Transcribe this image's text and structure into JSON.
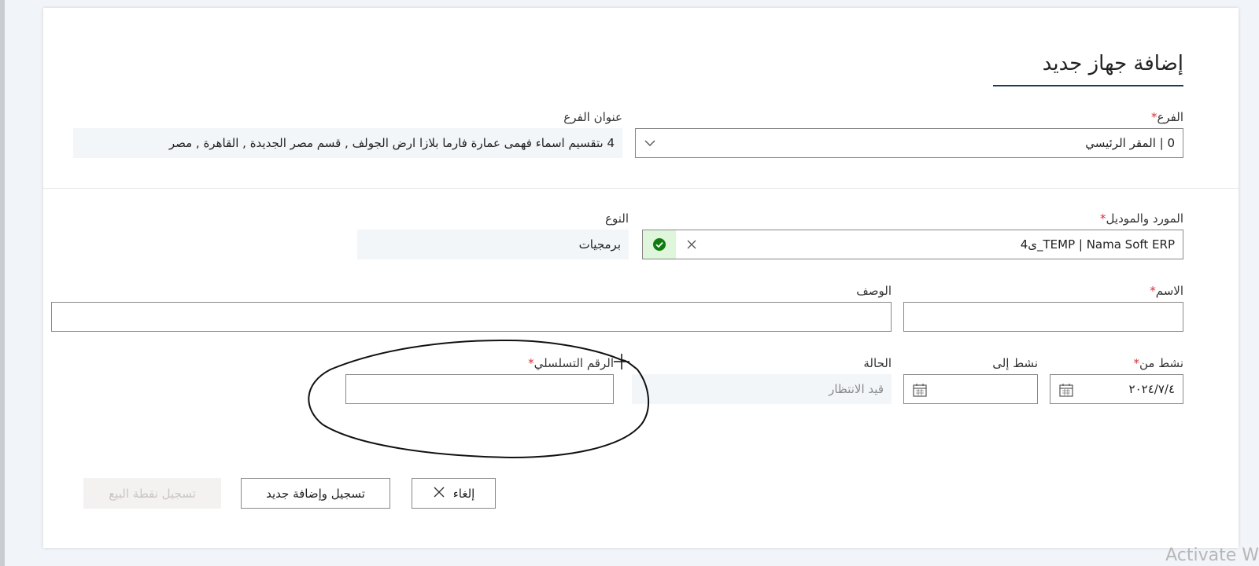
{
  "form": {
    "title": "إضافة جهاز جديد",
    "branch": {
      "label": "الفرع",
      "required_mark": "*",
      "value": "0 | المقر الرئيسي"
    },
    "branch_address": {
      "label": "عنوان الفرع",
      "value": "4 ىتقسيم اسماء فهمى عمارة فارما بلازا ارض الجولف , قسم مصر الجديدة , القاهرة , مصر"
    },
    "supplier_model": {
      "label": "المورد والموديل",
      "required_mark": "*",
      "value": "TEMP | Nama Soft ERP_ى4"
    },
    "type": {
      "label": "النوع",
      "value": "برمجيات"
    },
    "name": {
      "label": "الاسم",
      "required_mark": "*",
      "value": ""
    },
    "description": {
      "label": "الوصف",
      "value": ""
    },
    "active_from": {
      "label": "نشط من",
      "required_mark": "*",
      "value": "٢٠٢٤/٧/٤"
    },
    "active_to": {
      "label": "نشط إلى",
      "value": ""
    },
    "status": {
      "label": "الحالة",
      "value": "قيد الانتظار"
    },
    "serial": {
      "label": "الرقم التسلسلي",
      "required_mark": "*",
      "value": ""
    }
  },
  "buttons": {
    "cancel": "إلغاء",
    "save_and_new": "تسجيل وإضافة جديد",
    "save_pos": "تسجيل نقطة البيع"
  },
  "icons": {
    "branch_dropdown": "chevron-down-icon",
    "supplier_status": "check-circle-icon",
    "supplier_clear": "close-icon",
    "date_picker": "calendar-icon",
    "cancel_button": "close-icon"
  },
  "colors": {
    "required": "#d13438",
    "valid": "#107c10",
    "title_underline": "#1f3b57"
  },
  "watermark": "Activate W"
}
